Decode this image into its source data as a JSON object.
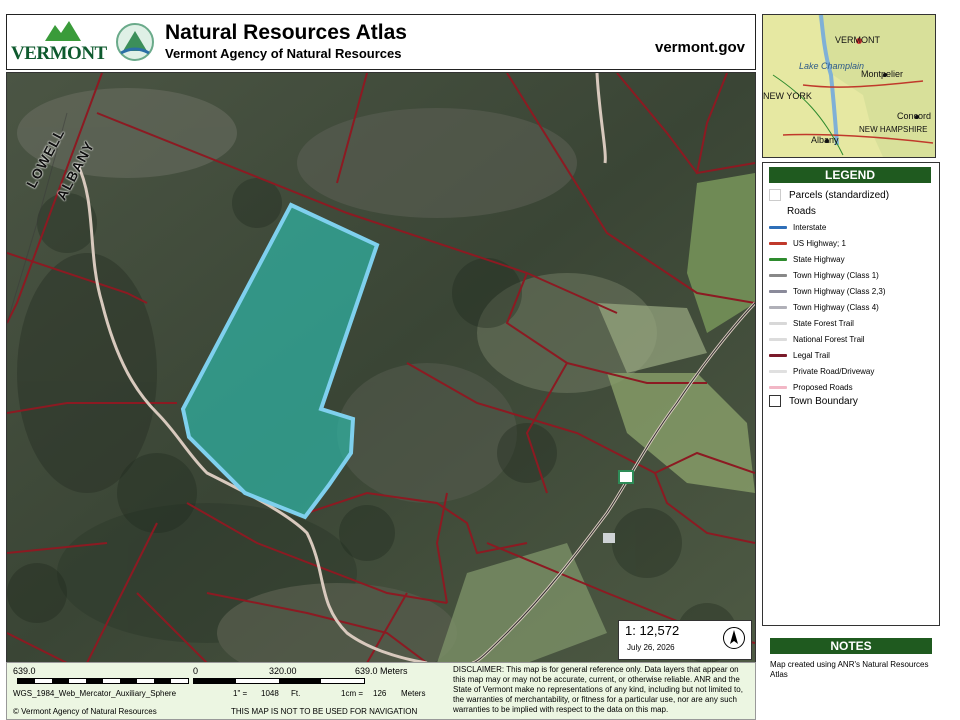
{
  "header": {
    "logo_text": "VERMONT",
    "title": "Natural Resources Atlas",
    "subtitle": "Vermont Agency of Natural Resources",
    "site": "vermont.gov"
  },
  "map": {
    "labels": {
      "town_lowell": "LOWELL",
      "town_albany": "ALBANY"
    }
  },
  "scale_box": {
    "ratio": "1: 12,572",
    "date": "July 26, 2026"
  },
  "footer": {
    "scale_left": "639.0",
    "scale_zero": "0",
    "scale_mid": "320.00",
    "scale_right": "639.0 Meters",
    "projection": "WGS_1984_Web_Mercator_Auxiliary_Sphere",
    "inch_label": "1\" =",
    "inch_value": "1048",
    "inch_unit": "Ft.",
    "cm_label": "1cm =",
    "cm_value": "126",
    "cm_unit": "Meters",
    "copyright": "© Vermont Agency of Natural Resources",
    "navigation_warning": "THIS MAP IS NOT TO BE USED FOR NAVIGATION",
    "disclaimer": "DISCLAIMER: This map is for general reference only. Data layers that appear on this map may or may not be accurate, current, or otherwise reliable. ANR and the State of Vermont make no representations of any kind, including but not limited to, the warranties of merchantability, or fitness for a particular use, nor are any such warranties to be implied with respect to the data on this map."
  },
  "overview": {
    "labels": [
      "VERMONT",
      "Lake Champlain",
      "Montpelier",
      "NEW YORK",
      "Concord",
      "NEW HAMPSHIRE",
      "Albany"
    ]
  },
  "legend": {
    "title": "LEGEND",
    "parcels": "Parcels (standardized)",
    "roads": "Roads",
    "items": [
      {
        "label": "Interstate",
        "color": "#2f6fb8"
      },
      {
        "label": "US Highway; 1",
        "color": "#c0392b"
      },
      {
        "label": "State Highway",
        "color": "#2e8b2e"
      },
      {
        "label": "Town Highway (Class 1)",
        "color": "#888888"
      },
      {
        "label": "Town Highway (Class 2,3)",
        "color": "#8a8a9a"
      },
      {
        "label": "Town Highway (Class 4)",
        "color": "#b0b0b8"
      },
      {
        "label": "State Forest Trail",
        "color": "#d8d8d8"
      },
      {
        "label": "National Forest Trail",
        "color": "#dcdcdc"
      },
      {
        "label": "Legal Trail",
        "color": "#7a1a2a"
      },
      {
        "label": "Private Road/Driveway",
        "color": "#e0e0e0"
      },
      {
        "label": "Proposed Roads",
        "color": "#f2b7c6"
      }
    ],
    "town_boundary": "Town Boundary"
  },
  "notes": {
    "title": "NOTES",
    "text": "Map created using ANR's Natural Resources Atlas"
  },
  "colors": {
    "parcel_line": "#8c1a22",
    "highlight_fill": "#2fb3a4",
    "highlight_stroke": "#7fd0ee",
    "road": "#d8c9bd",
    "legend_header": "#1f5a1f"
  }
}
